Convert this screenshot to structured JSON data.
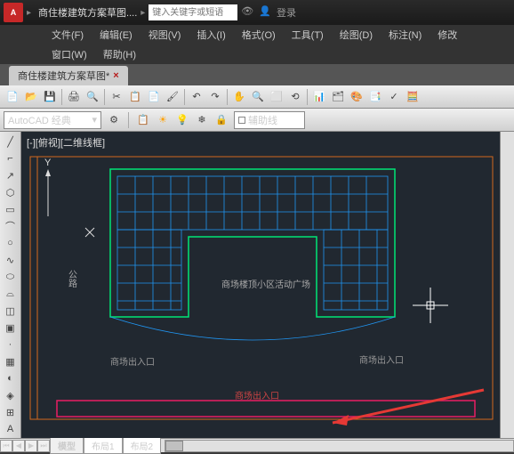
{
  "title": {
    "filename": "商住楼建筑方案草图....",
    "search_placeholder": "键入关键字或短语",
    "login": "登录"
  },
  "menu": {
    "file": "文件(F)",
    "edit": "编辑(E)",
    "view": "视图(V)",
    "insert": "插入(I)",
    "format": "格式(O)",
    "tools": "工具(T)",
    "draw": "绘图(D)",
    "dimension": "标注(N)",
    "modify": "修改",
    "window": "窗口(W)",
    "help": "帮助(H)"
  },
  "doctab": {
    "name": "商住楼建筑方案草图*"
  },
  "workspace": {
    "name": "AutoCAD 经典",
    "layer": "辅助线"
  },
  "canvas": {
    "view_label": "[-][俯视][二维线框]",
    "center_text": "商场楼顶小区活动广场",
    "road_text": "公路",
    "exit_left": "商场出入口",
    "exit_right": "商场出入口",
    "exit_bottom": "商场出入口"
  },
  "tabs": {
    "model": "模型",
    "layout1": "布局1",
    "layout2": "布局2"
  }
}
